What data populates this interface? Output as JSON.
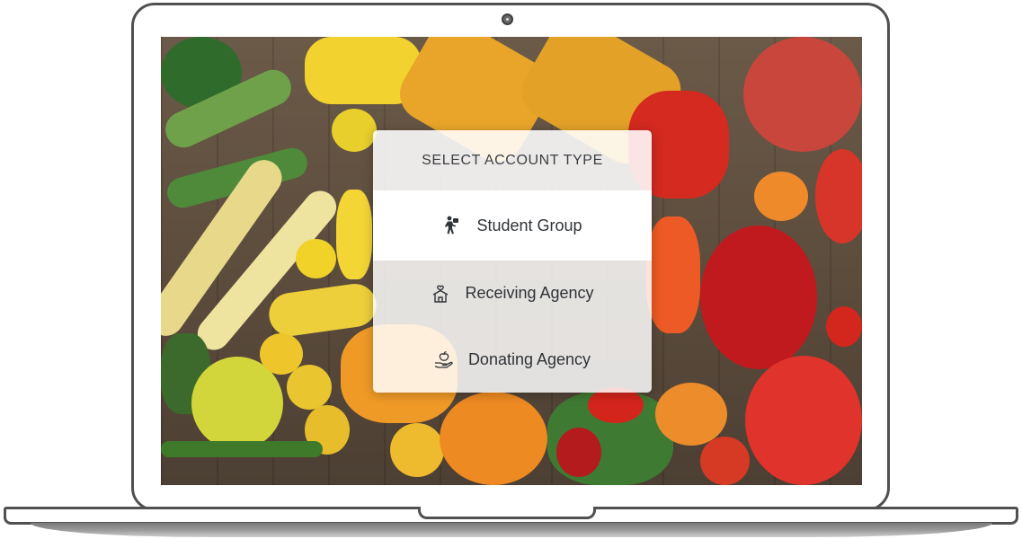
{
  "dialog": {
    "title": "SELECT ACCOUNT TYPE",
    "options": [
      {
        "label": "Student Group",
        "icon": "student-icon"
      },
      {
        "label": "Receiving Agency",
        "icon": "house-heart-icon"
      },
      {
        "label": "Donating Agency",
        "icon": "hand-apple-icon"
      }
    ]
  },
  "colors": {
    "title_text": "#3b3f44",
    "option_text": "#2f3338",
    "laptop_frame": "#505050"
  }
}
